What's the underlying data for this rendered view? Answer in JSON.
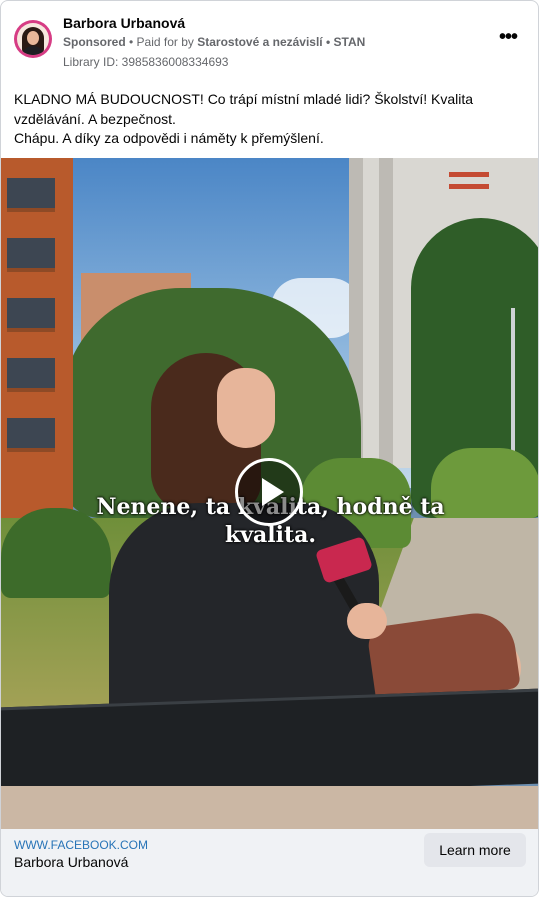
{
  "header": {
    "name": "Barbora Urbanová",
    "sponsored": "Sponsored",
    "paid_for_prefix": " • Paid for by ",
    "payer": "Starostové a nezávislí • STAN",
    "library_id": "Library ID: 3985836008334693",
    "more_icon": "more-horizontal-icon",
    "more_glyph": "•••"
  },
  "post": {
    "line1": "KLADNO MÁ BUDOUCNOST! Co trápí místní mladé lidi? Školství! Kvalita vzdělávání. A bezpečnost.",
    "line2": "Chápu. A díky za odpovědi i náměty k přemýšlení."
  },
  "video": {
    "caption_line1": "Nenene, ta kvalita, hodně ta",
    "caption_line2": "kvalita.",
    "play_icon": "play-icon"
  },
  "footer": {
    "domain": "WWW.FACEBOOK.COM",
    "title": "Barbora Urbanová",
    "cta_label": "Learn more"
  },
  "colors": {
    "link_blue": "#2874b7",
    "footer_bg": "#f0f2f5",
    "button_bg": "#e4e6eb"
  }
}
